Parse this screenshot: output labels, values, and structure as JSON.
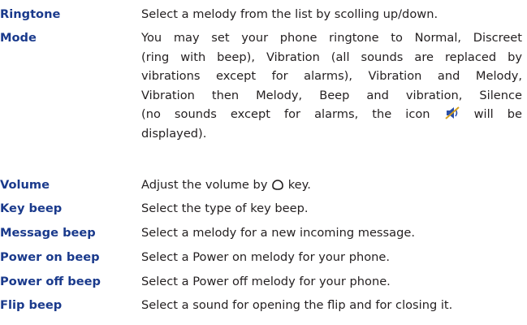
{
  "entries": [
    {
      "term": "Ringtone",
      "description": "Select a melody from the list by scolling up/down."
    },
    {
      "term": "Mode",
      "description_lines": [
        "You may set your phone ringtone to Normal, Discreet",
        "(ring with beep), Vibration (all sounds are replaced by",
        "vibrations except for alarms), Vibration and Melody,",
        "Vibration then Melody, Beep and vibration, Silence",
        "(no sounds except for alarms, the icon",
        "will be",
        "displayed)."
      ]
    },
    {
      "term": "Volume",
      "description_before": "Adjust the volume by",
      "description_after": "key."
    },
    {
      "term": "Key beep",
      "description": "Select the type of key beep."
    },
    {
      "term": "Message beep",
      "description": "Select a melody for a new incoming message."
    },
    {
      "term": "Power on beep",
      "description": "Select a Power on melody for your phone."
    },
    {
      "term": "Power off beep",
      "description": "Select a Power off melody for your phone."
    },
    {
      "term": "Flip beep",
      "description": "Select a sound for opening the flip and for closing it."
    }
  ],
  "icons": {
    "silence": "silent-mode-icon",
    "key": "navigation-key-icon"
  },
  "colors": {
    "term": "#1a3a8c",
    "text": "#231f20",
    "icon_blue": "#2a4fa8"
  }
}
